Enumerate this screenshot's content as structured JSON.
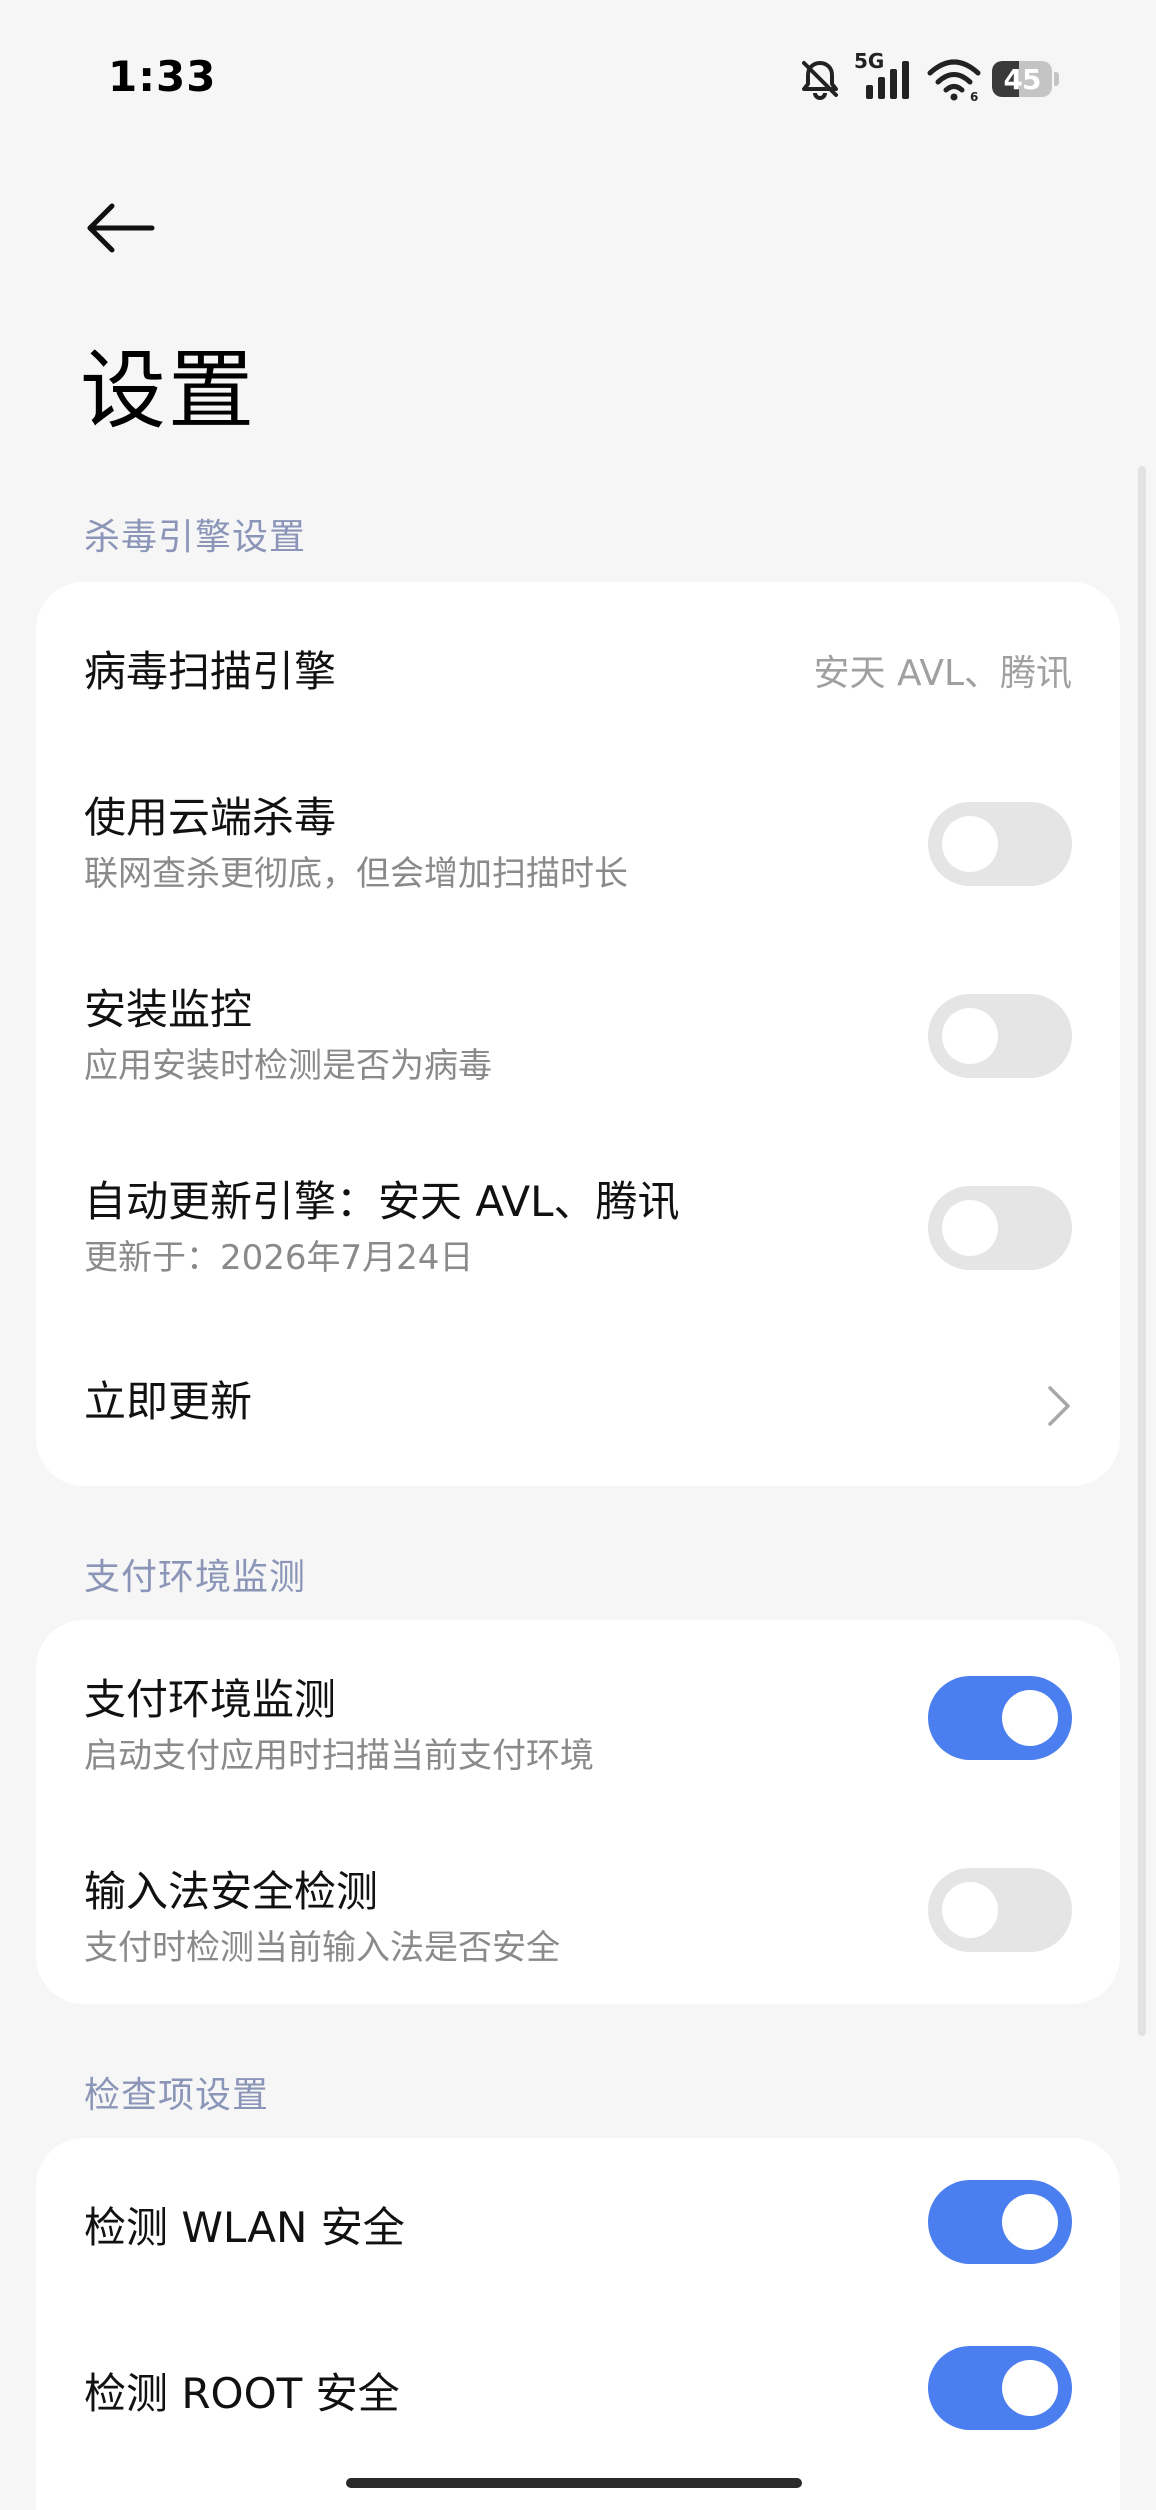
{
  "status_bar": {
    "time": "1:33",
    "network": "5G",
    "battery_level": 45,
    "icons": [
      "bell-muted-icon",
      "signal-icon",
      "wifi-icon",
      "battery-icon"
    ]
  },
  "header": {
    "back_icon": "arrow-left-icon",
    "title": "设置"
  },
  "colors": {
    "accent": "#4b7ff0",
    "toggle_off": "#e5e5e5",
    "section_label": "#8b95b8",
    "secondary_text": "#8a8a8a"
  },
  "sections": [
    {
      "label": "杀毒引擎设置",
      "items": [
        {
          "title": "病毒扫描引擎",
          "value": "安天 AVL、腾讯"
        },
        {
          "title": "使用云端杀毒",
          "subtitle": "联网查杀更彻底，但会增加扫描时长",
          "enabled": false
        },
        {
          "title": "安装监控",
          "subtitle": "应用安装时检测是否为病毒",
          "enabled": false
        },
        {
          "title": "自动更新引擎：安天 AVL、腾讯",
          "subtitle": "更新于：2026年7月24日",
          "enabled": false
        },
        {
          "title": "立即更新",
          "icon": "chevron-right-icon"
        }
      ]
    },
    {
      "label": "支付环境监测",
      "items": [
        {
          "title": "支付环境监测",
          "subtitle": "启动支付应用时扫描当前支付环境",
          "enabled": true
        },
        {
          "title": "输入法安全检测",
          "subtitle": "支付时检测当前输入法是否安全",
          "enabled": false
        }
      ]
    },
    {
      "label": "检查项设置",
      "items": [
        {
          "title": "检测 WLAN 安全",
          "enabled": true
        },
        {
          "title": "检测 ROOT 安全",
          "enabled": true
        }
      ]
    }
  ]
}
